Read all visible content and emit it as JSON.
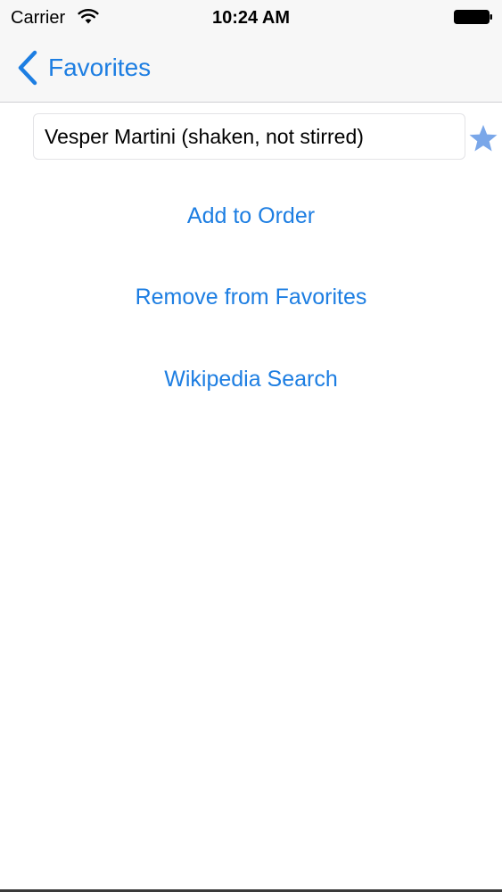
{
  "status_bar": {
    "carrier": "Carrier",
    "time": "10:24 AM",
    "wifi_icon": "wifi-icon",
    "battery_icon": "battery-icon"
  },
  "nav": {
    "back_label": "Favorites",
    "back_icon": "chevron-left-icon"
  },
  "drink": {
    "name": "Vesper Martini (shaken, not stirred)",
    "favorite_icon": "star-icon",
    "favorite_color": "#7aa7e9"
  },
  "actions": {
    "add_to_order": "Add to Order",
    "remove_from_favorites": "Remove from Favorites",
    "wikipedia_search": "Wikipedia Search"
  },
  "colors": {
    "accent": "#1d7ee2",
    "bar_background": "#f7f7f7"
  }
}
